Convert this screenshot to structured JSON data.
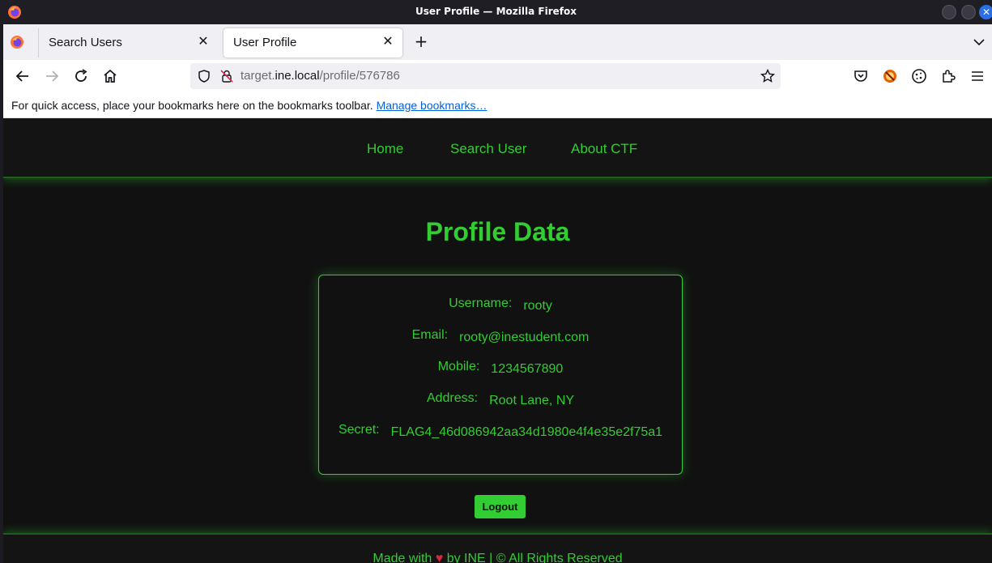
{
  "window": {
    "title": "User Profile — Mozilla Firefox"
  },
  "tabs": [
    {
      "label": "Search Users",
      "active": false
    },
    {
      "label": "User Profile",
      "active": true
    }
  ],
  "address_bar": {
    "url_prefix": "target.",
    "url_host": "ine.local",
    "url_path": "/profile/576786"
  },
  "bookmarks_bar": {
    "message": "For quick access, place your bookmarks here on the bookmarks toolbar.",
    "link": "Manage bookmarks…"
  },
  "site_nav": {
    "items": [
      "Home",
      "Search User",
      "About CTF"
    ]
  },
  "profile": {
    "heading": "Profile Data",
    "fields": [
      {
        "label": "Username:",
        "value": "rooty"
      },
      {
        "label": "Email:",
        "value": "rooty@inestudent.com"
      },
      {
        "label": "Mobile:",
        "value": "1234567890"
      },
      {
        "label": "Address:",
        "value": "Root Lane, NY"
      },
      {
        "label": "Secret:",
        "value": "FLAG4_46d086942aa34d1980e4f4e35e2f75a1"
      }
    ],
    "logout_label": "Logout"
  },
  "footer": {
    "before_heart": "Made with",
    "heart": "♥",
    "after_heart": "by INE | © All Rights Reserved"
  },
  "colors": {
    "accent": "#32cd32",
    "page_bg": "#111111",
    "heart": "#d7263d",
    "link": "#0060df"
  }
}
